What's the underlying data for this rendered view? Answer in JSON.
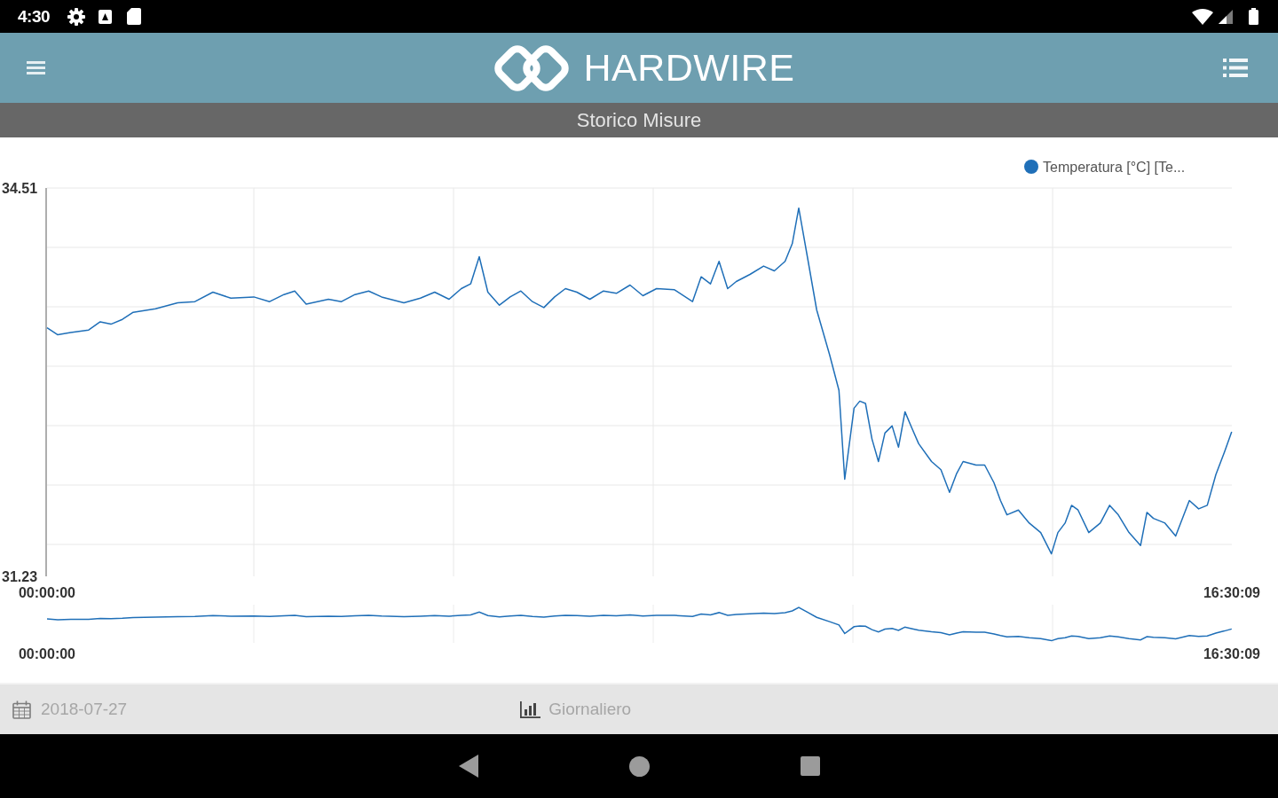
{
  "status_bar": {
    "time": "4:30"
  },
  "app_bar": {
    "brand": "HARDWIRE"
  },
  "page_title": "Storico Misure",
  "chart": {
    "chart_data": [
      {
        "type": "line",
        "x": [
          0,
          0.15,
          0.33,
          0.58,
          0.74,
          0.89,
          1.05,
          1.2,
          1.51,
          1.82,
          2.06,
          2.31,
          2.56,
          2.88,
          3.1,
          3.3,
          3.45,
          3.61,
          3.92,
          4.1,
          4.29,
          4.48,
          4.66,
          4.97,
          5.2,
          5.4,
          5.6,
          5.77,
          5.9,
          6.02,
          6.14,
          6.3,
          6.45,
          6.6,
          6.76,
          6.92,
          7.07,
          7.22,
          7.38,
          7.56,
          7.75,
          7.93,
          8.12,
          8.3,
          8.49,
          8.74,
          8.99,
          9.11,
          9.24,
          9.36,
          9.48,
          9.6,
          9.79,
          9.98,
          10.13,
          10.28,
          10.38,
          10.47,
          10.59,
          10.72,
          10.9,
          11.03,
          11.11,
          11.24,
          11.32,
          11.4,
          11.49,
          11.58,
          11.67,
          11.77,
          11.86,
          11.95,
          12.04,
          12.14,
          12.32,
          12.45,
          12.57,
          12.67,
          12.76,
          12.94,
          13.06,
          13.19,
          13.28,
          13.37,
          13.53,
          13.68,
          13.84,
          13.99,
          14.08,
          14.18,
          14.27,
          14.36,
          14.51,
          14.67,
          14.8,
          14.92,
          15.07,
          15.23,
          15.32,
          15.41,
          15.57,
          15.72,
          15.91,
          16.04,
          16.16,
          16.28,
          16.4,
          16.5
        ],
        "series": [
          {
            "name": "Temperatura [°C] [Te...",
            "color": "#1f6fb8",
            "values": [
              33.33,
              33.27,
              33.29,
              33.31,
              33.38,
              33.36,
              33.4,
              33.46,
              33.49,
              33.54,
              33.55,
              33.63,
              33.58,
              33.59,
              33.55,
              33.61,
              33.64,
              33.53,
              33.57,
              33.55,
              33.61,
              33.64,
              33.59,
              33.54,
              33.58,
              33.63,
              33.57,
              33.66,
              33.7,
              33.93,
              33.63,
              33.52,
              33.59,
              33.64,
              33.55,
              33.5,
              33.59,
              33.66,
              33.63,
              33.57,
              33.64,
              33.62,
              33.69,
              33.6,
              33.66,
              33.65,
              33.55,
              33.76,
              33.7,
              33.89,
              33.66,
              33.72,
              33.78,
              33.85,
              33.81,
              33.89,
              34.04,
              34.34,
              33.93,
              33.48,
              33.1,
              32.8,
              32.05,
              32.65,
              32.71,
              32.69,
              32.39,
              32.2,
              32.44,
              32.5,
              32.32,
              32.62,
              32.49,
              32.35,
              32.2,
              32.13,
              31.94,
              32.1,
              32.2,
              32.17,
              32.17,
              32.02,
              31.87,
              31.75,
              31.79,
              31.68,
              31.6,
              31.42,
              31.6,
              31.68,
              31.83,
              31.79,
              31.6,
              31.68,
              31.83,
              31.75,
              31.6,
              31.49,
              31.77,
              31.72,
              31.68,
              31.57,
              31.87,
              31.8,
              31.83,
              32.09,
              32.28,
              32.45
            ]
          }
        ],
        "xlim": [
          0,
          16.5025
        ],
        "ylim": [
          31.23,
          34.51
        ],
        "xticks": [
          {
            "value": 0,
            "label": "00:00:00"
          },
          {
            "value": 16.5025,
            "label": "16:30:09"
          }
        ],
        "yticks": [
          34.51,
          31.23
        ],
        "grid": true,
        "legend": "top-right"
      }
    ]
  },
  "navigator": {
    "start_label": "00:00:00",
    "end_label": "16:30:09"
  },
  "footer": {
    "date": "2018-07-27",
    "period": "Giornaliero"
  }
}
